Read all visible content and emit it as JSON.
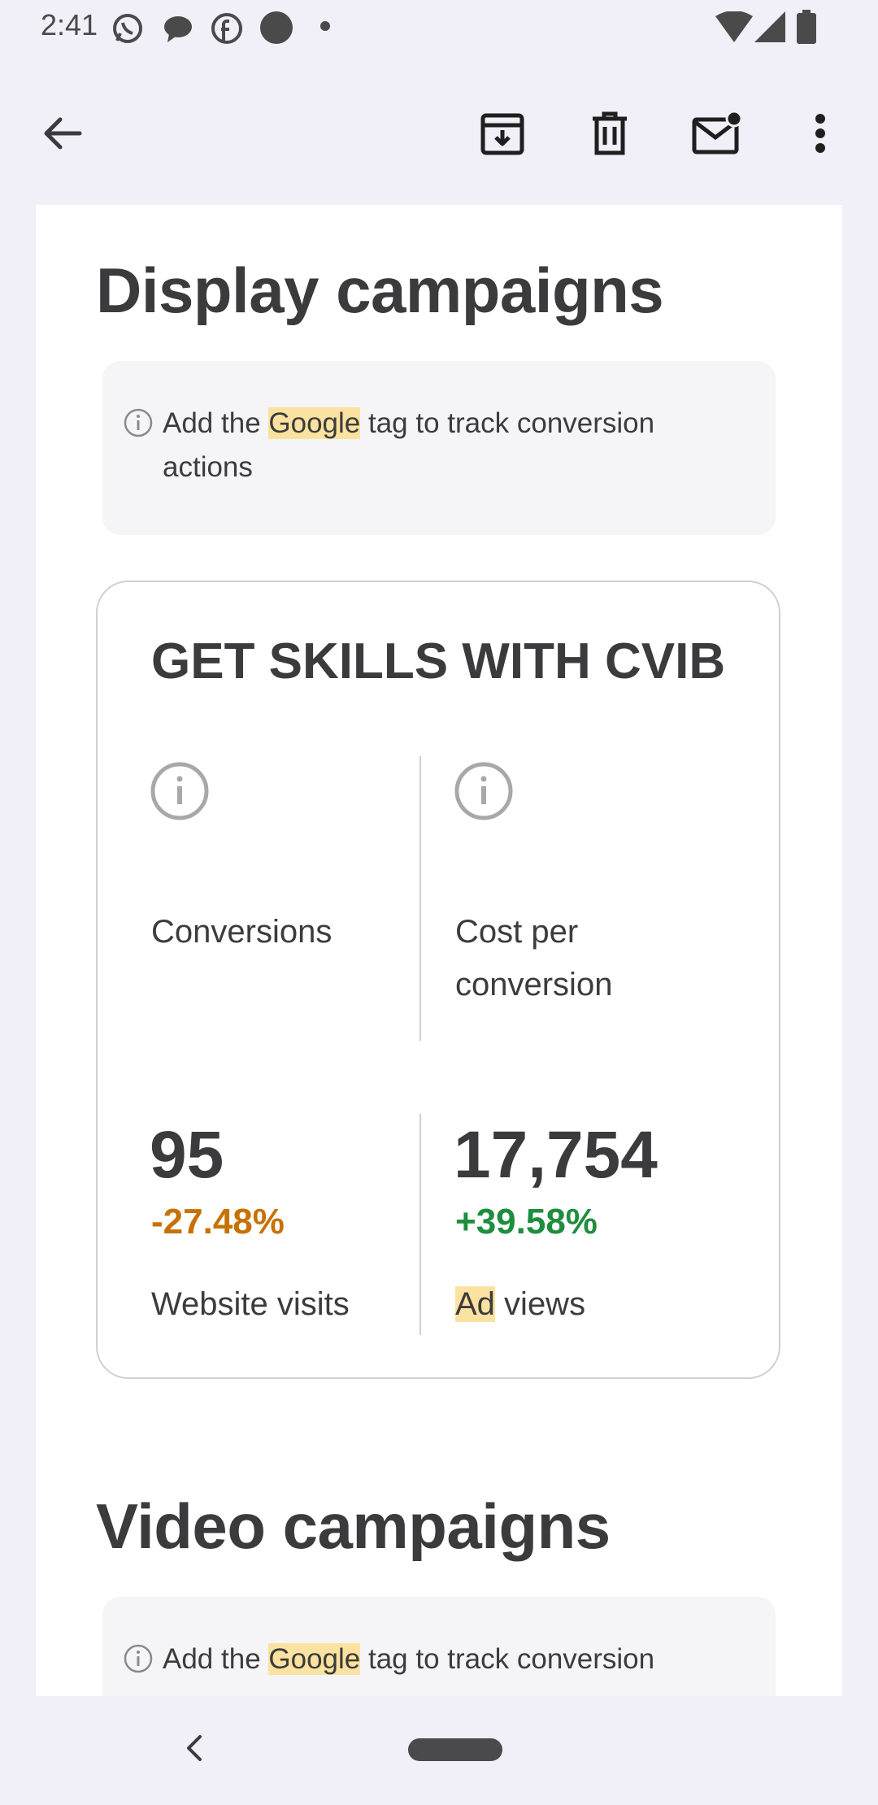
{
  "status_bar": {
    "time": "2:41",
    "left_icons": [
      "whatsapp-icon",
      "chat-bubble-icon",
      "facebook-icon",
      "dot-icon",
      "small-dot-icon"
    ],
    "right_icons": [
      "wifi-icon",
      "signal-icon",
      "battery-icon"
    ]
  },
  "toolbar": {
    "actions": [
      "back",
      "archive",
      "delete",
      "mark-unread",
      "more"
    ]
  },
  "display_section": {
    "title": "Display campaigns",
    "note": {
      "before": "Add the ",
      "highlight": "Google",
      "after": " tag to track conversion actions"
    },
    "card": {
      "title": "GET SKILLS WITH CVIB",
      "left": {
        "label": "Conversions",
        "value": "95",
        "delta": "-27.48%",
        "sub_label": "Website visits"
      },
      "right": {
        "label": "Cost per conversion",
        "value": "17,754",
        "delta": "+39.58%",
        "sub_label_highlight": "Ad",
        "sub_label_rest": " views"
      }
    }
  },
  "video_section": {
    "title": "Video campaigns",
    "note": {
      "before": "Add the ",
      "highlight": "Google",
      "after": " tag to track conversion"
    }
  },
  "colors": {
    "negative_delta": "#c67200",
    "positive_delta": "#1e8e3e",
    "highlight": "#fbe2a0",
    "background": "#f1eff7"
  }
}
